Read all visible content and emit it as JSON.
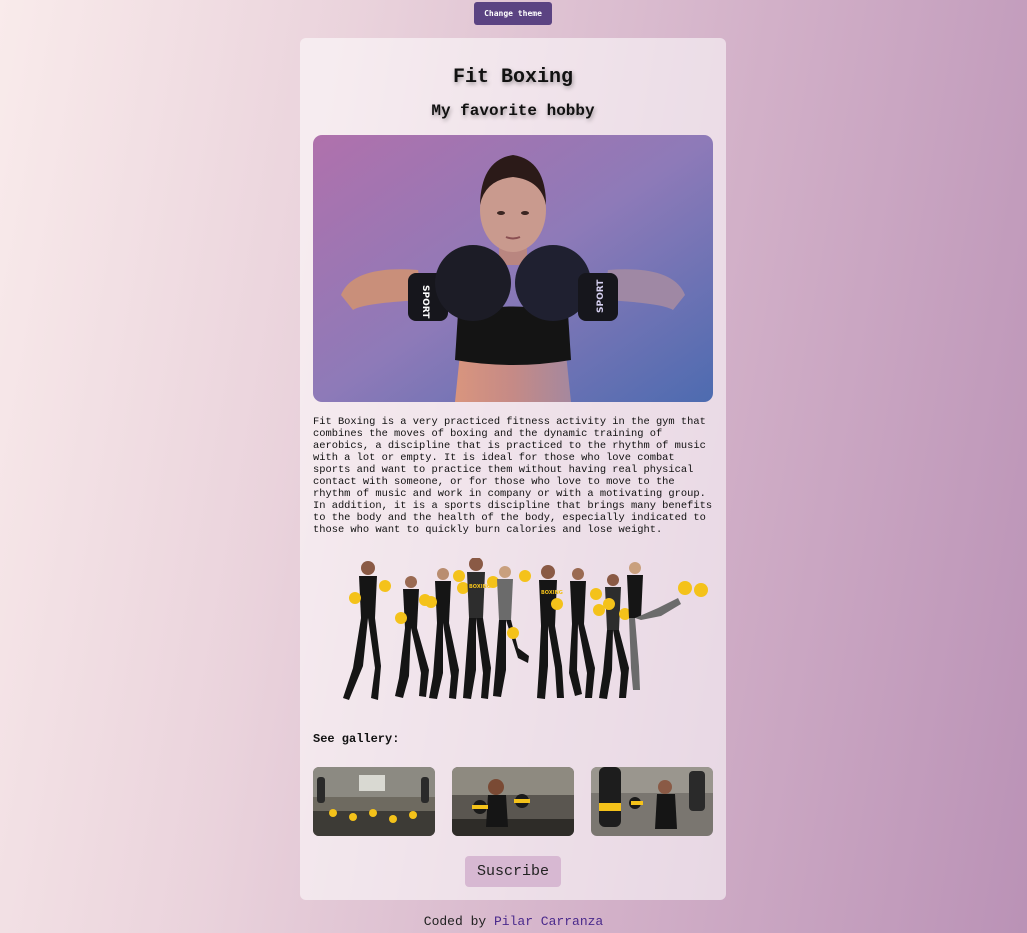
{
  "theme_button": {
    "label": "Change theme"
  },
  "card": {
    "title": "Fit Boxing",
    "subtitle": "My favorite hobby",
    "description": "Fit Boxing is a very practiced fitness activity in the gym that combines the moves of boxing and the dynamic training of aerobics, a discipline that is practiced to the rhythm of music with a lot or empty. It is ideal for those who love combat sports and want to practice them without having real physical contact with someone, or for those who love to move to the rhythm of music and work in company or with a motivating group. In addition, it is a sports discipline that brings many benefits to the body and the health of the body, especially indicated to those who want to quickly burn calories and lose weight.",
    "gallery_label": "See gallery:",
    "subscribe_label": "Suscribe"
  },
  "hero_glove_text": "SPORT",
  "group_shirt_text": "BOXING",
  "footer": {
    "prefix": "Coded by ",
    "author": "Pilar Carranza"
  },
  "colors": {
    "accent": "#5b4382",
    "link": "#4a2a8c",
    "subscribe_bg": "#d7b8d2",
    "glove_yellow": "#f4c21a"
  }
}
